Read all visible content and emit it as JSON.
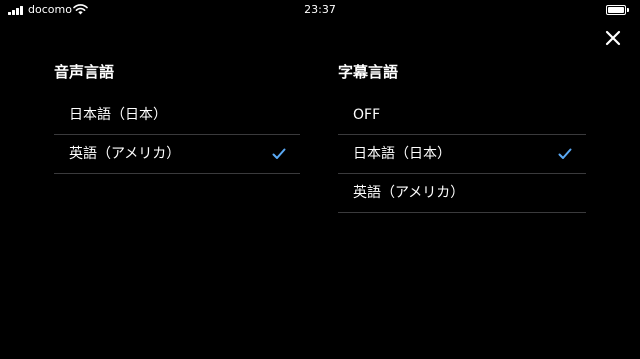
{
  "status_bar": {
    "carrier": "docomo",
    "time": "23:37",
    "icons": [
      "signal-bars-icon",
      "wifi-icon",
      "battery-icon"
    ]
  },
  "close_icon": "close-icon",
  "accent_color": "#5aa9f5",
  "audio": {
    "title": "音声言語",
    "options": [
      {
        "label": "日本語（日本）",
        "selected": false
      },
      {
        "label": "英語（アメリカ）",
        "selected": true
      }
    ]
  },
  "subtitles": {
    "title": "字幕言語",
    "options": [
      {
        "label": "OFF",
        "selected": false
      },
      {
        "label": "日本語（日本）",
        "selected": true
      },
      {
        "label": "英語（アメリカ）",
        "selected": false
      }
    ]
  }
}
